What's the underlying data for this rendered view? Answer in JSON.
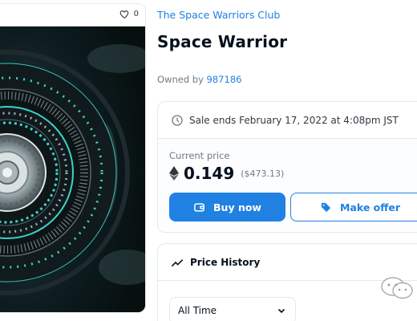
{
  "media": {
    "favorites_count": "0"
  },
  "item": {
    "collection_name": "The Space Warriors Club",
    "title": "Space Warrior",
    "owned_by_label": "Owned by",
    "owner": "987186"
  },
  "sale": {
    "ends_text": "Sale ends February 17, 2022 at 4:08pm JST",
    "current_price_label": "Current price",
    "price": "0.149",
    "price_usd": "($473.13)",
    "buy_label": "Buy now",
    "offer_label": "Make offer"
  },
  "price_history": {
    "title": "Price History",
    "range_selected": "All Time"
  },
  "colors": {
    "accent": "#2081e2",
    "text_primary": "#04111d",
    "text_secondary": "#707a83",
    "border": "#e5e8eb",
    "art_glow": "#3fd3c8"
  }
}
